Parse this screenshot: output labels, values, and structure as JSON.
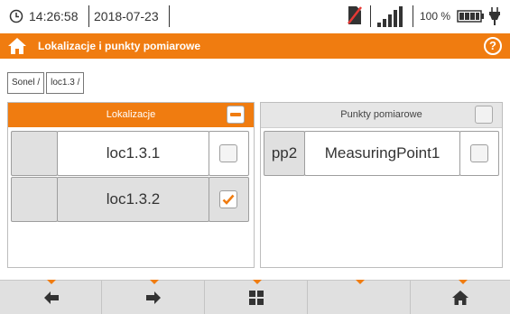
{
  "status_bar": {
    "time": "14:26:58",
    "date": "2018-07-23",
    "battery_percent": "100 %",
    "icons": [
      "clock-icon",
      "simcard-icon",
      "signal-icon",
      "battery-icon",
      "charging-icon"
    ]
  },
  "title_bar": {
    "title": "Lokalizacje i punkty pomiarowe",
    "accent_color": "#f07c10",
    "icons": [
      "home-icon",
      "help-icon"
    ]
  },
  "breadcrumb": [
    "Sonel /",
    "loc1.3 /"
  ],
  "locations_panel": {
    "header": "Lokalizacje",
    "header_checkbox_state": "partial",
    "rows": [
      {
        "name": "loc1.3.1",
        "checked": false
      },
      {
        "name": "loc1.3.2",
        "checked": true
      }
    ]
  },
  "points_panel": {
    "header": "Punkty pomiarowe",
    "header_checkbox_state": "unchecked",
    "rows": [
      {
        "id": "pp2",
        "name": "MeasuringPoint1",
        "checked": false
      }
    ]
  },
  "bottom_bar": {
    "buttons": [
      "arrow-left-icon",
      "arrow-right-icon",
      "grid-icon",
      "empty",
      "home-icon"
    ]
  }
}
